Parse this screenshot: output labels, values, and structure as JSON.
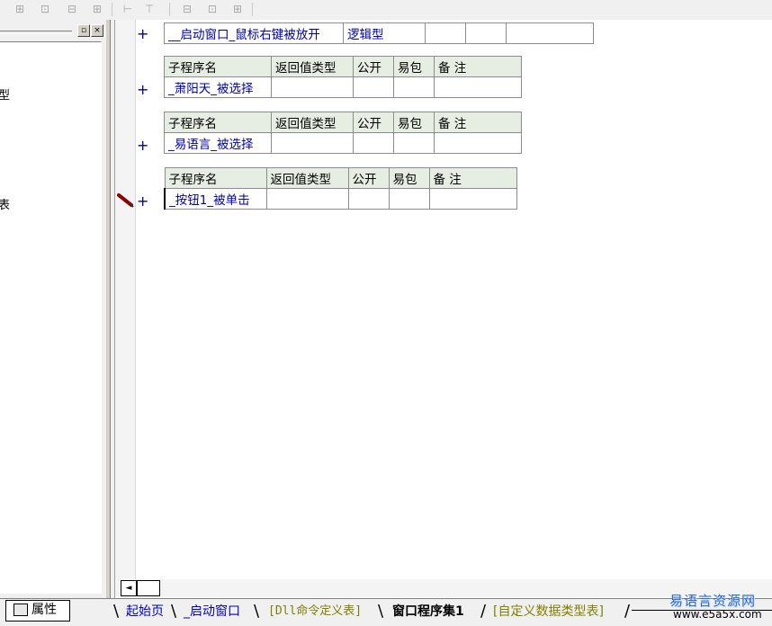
{
  "toolbar": {
    "icons": [
      "align-left-icon",
      "align-center-icon",
      "align-top-icon",
      "align-middle-icon",
      "h-space-icon",
      "v-space-icon",
      "same-width-icon",
      "same-height-icon",
      "same-size-icon"
    ]
  },
  "left_panel": {
    "close_glyph": "×",
    "max_glyph": "▫",
    "cut_texts": [
      "型",
      "表"
    ],
    "property_tab_label": "属性"
  },
  "code": {
    "top_row": {
      "name": "__启动窗口_鼠标右键被放开",
      "type": "逻辑型"
    },
    "headers": [
      "子程序名",
      "返回值类型",
      "公开",
      "易包",
      "备 注"
    ],
    "subs": [
      {
        "name": "_萧阳天_被选择"
      },
      {
        "name": "_易语言_被选择"
      },
      {
        "name": "_按钮1_被单击"
      }
    ],
    "plus": "+"
  },
  "scrollbar": {
    "left_arrow": "◄"
  },
  "tabs": [
    {
      "label": "起始页"
    },
    {
      "label": "_启动窗口"
    },
    {
      "label": "[Dll命令定义表]"
    },
    {
      "label": "窗口程序集1"
    },
    {
      "label": "[自定义数据类型表]"
    }
  ],
  "watermark": {
    "line1": "易语言资源网",
    "line2": "www.e5a5x.com"
  }
}
